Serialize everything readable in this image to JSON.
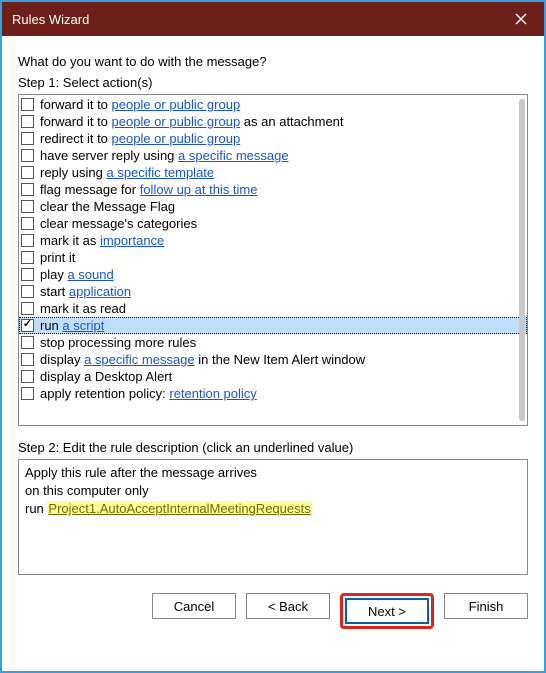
{
  "window": {
    "title": "Rules Wizard"
  },
  "prompt": "What do you want to do with the message?",
  "step1_label": "Step 1: Select action(s)",
  "actions": [
    {
      "pre": "forward it to ",
      "link": "people or public group",
      "post": "",
      "checked": false
    },
    {
      "pre": "forward it to ",
      "link": "people or public group",
      "post": " as an attachment",
      "checked": false
    },
    {
      "pre": "redirect it to ",
      "link": "people or public group",
      "post": "",
      "checked": false
    },
    {
      "pre": "have server reply using ",
      "link": "a specific message",
      "post": "",
      "checked": false
    },
    {
      "pre": "reply using ",
      "link": "a specific template",
      "post": "",
      "checked": false
    },
    {
      "pre": "flag message for ",
      "link": "follow up at this time",
      "post": "",
      "checked": false
    },
    {
      "pre": "clear the Message Flag",
      "link": "",
      "post": "",
      "checked": false
    },
    {
      "pre": "clear message's categories",
      "link": "",
      "post": "",
      "checked": false
    },
    {
      "pre": "mark it as ",
      "link": "importance",
      "post": "",
      "checked": false
    },
    {
      "pre": "print it",
      "link": "",
      "post": "",
      "checked": false
    },
    {
      "pre": "play ",
      "link": "a sound",
      "post": "",
      "checked": false
    },
    {
      "pre": "start ",
      "link": "application",
      "post": "",
      "checked": false
    },
    {
      "pre": "mark it as read",
      "link": "",
      "post": "",
      "checked": false
    },
    {
      "pre": "run ",
      "link": "a script",
      "post": "",
      "checked": true,
      "selected": true
    },
    {
      "pre": "stop processing more rules",
      "link": "",
      "post": "",
      "checked": false
    },
    {
      "pre": "display ",
      "link": "a specific message",
      "post": " in the New Item Alert window",
      "checked": false
    },
    {
      "pre": "display a Desktop Alert",
      "link": "",
      "post": "",
      "checked": false
    },
    {
      "pre": "apply retention policy: ",
      "link": "retention policy",
      "post": "",
      "checked": false
    }
  ],
  "step2_label": "Step 2: Edit the rule description (click an underlined value)",
  "description": {
    "line1": "Apply this rule after the message arrives",
    "line2": "on this computer only",
    "line3_pre": "run ",
    "line3_link": "Project1.AutoAcceptInternalMeetingRequests"
  },
  "buttons": {
    "cancel": "Cancel",
    "back": "< Back",
    "next": "Next >",
    "finish": "Finish"
  }
}
